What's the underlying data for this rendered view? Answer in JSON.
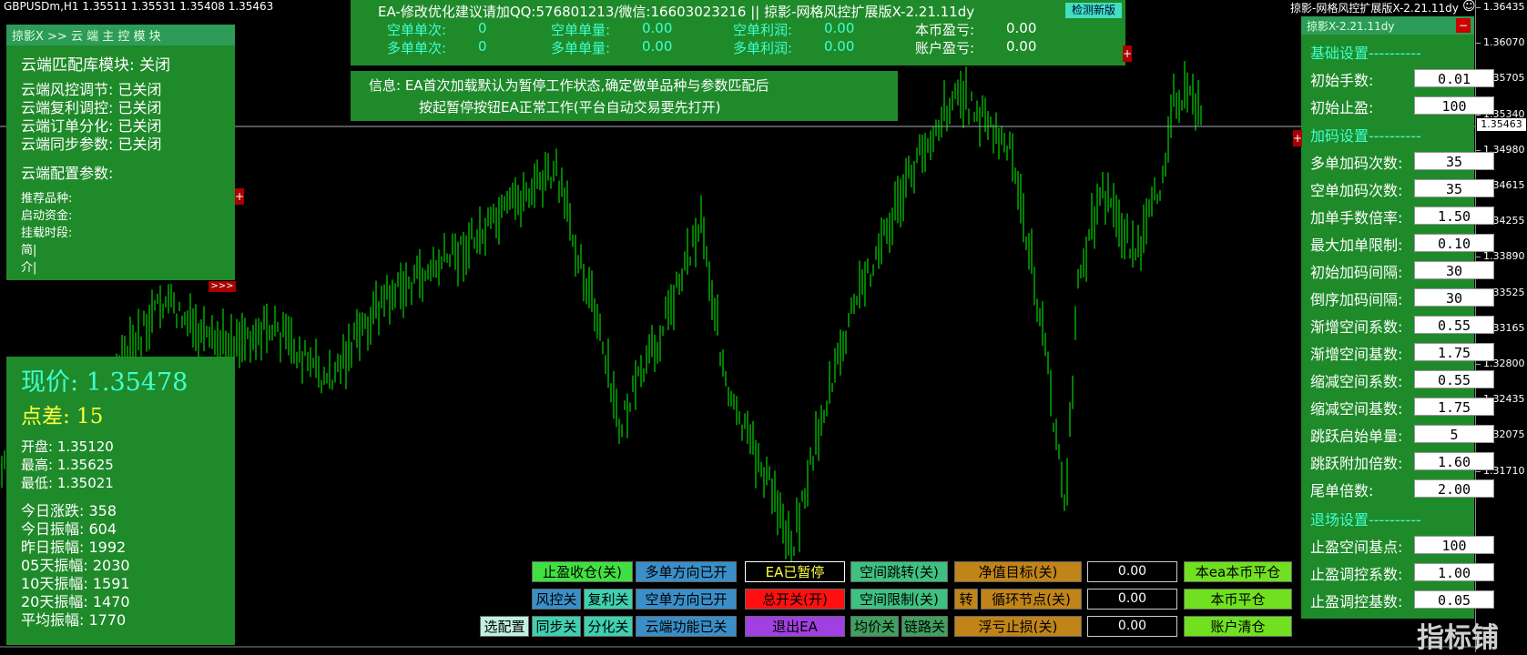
{
  "chart": {
    "symbol_line": "GBPUSDm,H1  1.35511  1.35531  1.35408  1.35463",
    "top_right_title": "掠影-网格风控扩展版X-2.21.11dy",
    "current_price_tag": "1.35463",
    "price_axis": [
      "1.36435",
      "1.36070",
      "1.35705",
      "1.35340",
      "1.34980",
      "1.34615",
      "1.34255",
      "1.33890",
      "1.33525",
      "1.33165",
      "1.32800",
      "1.32435",
      "1.32075",
      "1.31710"
    ],
    "bar_color": "#00ff00"
  },
  "top_panel": {
    "title": "EA-修改优化建议请加QQ:576801213/微信:16603023216 || 掠影-网格风控扩展版X-2.21.11dy",
    "check_button": "检测新版",
    "stats": [
      {
        "label": "空单单次:",
        "value": "0"
      },
      {
        "label": "空单单量:",
        "value": "0.00"
      },
      {
        "label": "空单利润:",
        "value": "0.00"
      },
      {
        "label": "本币盈亏:",
        "value": "0.00"
      },
      {
        "label": "多单单次:",
        "value": "0"
      },
      {
        "label": "多单单量:",
        "value": "0.00"
      },
      {
        "label": "多单利润:",
        "value": "0.00"
      },
      {
        "label": "账户盈亏:",
        "value": "0.00"
      }
    ]
  },
  "info_panel": {
    "line1": "信息: EA首次加载默认为暂停工作状态,确定做单品种与参数匹配后",
    "line2": "按起暂停按钮EA正常工作(平台自动交易要先打开)"
  },
  "cloud_panel": {
    "header": "掠影X >> 云 端 主 控 模 块",
    "match": "云端匹配库模块: 关闭",
    "items": [
      "云端风控调节: 已关闭",
      "云端复利调控: 已关闭",
      "云端订单分化: 已关闭",
      "云端同步参数: 已关闭"
    ],
    "config_title": "云端配置参数:",
    "config_items": [
      "推荐品种:",
      "启动资金:",
      "挂载时段:",
      "简|",
      "介|"
    ],
    "expand": ">>>"
  },
  "price_panel": {
    "current": "现价: 1.35478",
    "spread": "点差: 15",
    "ohl": [
      "开盘: 1.35120",
      "最高: 1.35625",
      "最低: 1.35021"
    ],
    "stats": [
      "今日涨跌: 358",
      "今日振幅: 604",
      "昨日振幅: 1992",
      "05天振幅: 2030",
      "10天振幅: 1591",
      "20天振幅: 1470",
      "平均振幅: 1770"
    ]
  },
  "right_panel": {
    "title": "掠影X-2.21.11dy",
    "close": "−",
    "section1": "基础设置----------",
    "section2": "加码设置----------",
    "section3": "退场设置----------",
    "basic": [
      {
        "label": "初始手数:",
        "value": "0.01"
      },
      {
        "label": "初始止盈:",
        "value": "100"
      }
    ],
    "add": [
      {
        "label": "多单加码次数:",
        "value": "35"
      },
      {
        "label": "空单加码次数:",
        "value": "35"
      },
      {
        "label": "加单手数倍率:",
        "value": "1.50"
      },
      {
        "label": "最大加单限制:",
        "value": "0.10"
      },
      {
        "label": "初始加码间隔:",
        "value": "30"
      },
      {
        "label": "倒序加码间隔:",
        "value": "30"
      },
      {
        "label": "渐增空间系数:",
        "value": "0.55"
      },
      {
        "label": "渐增空间基数:",
        "value": "1.75"
      },
      {
        "label": "缩减空间系数:",
        "value": "0.55"
      },
      {
        "label": "缩减空间基数:",
        "value": "1.75"
      },
      {
        "label": "跳跃启始单量:",
        "value": "5"
      },
      {
        "label": "跳跃附加倍数:",
        "value": "1.60"
      },
      {
        "label": "尾单倍数:",
        "value": "2.00"
      }
    ],
    "exit": [
      {
        "label": "止盈空间基点:",
        "value": "100"
      },
      {
        "label": "止盈调控系数:",
        "value": "1.00"
      },
      {
        "label": "止盈调控基数:",
        "value": "0.05"
      }
    ]
  },
  "buttons": {
    "tp_close": "止盈收仓(关)",
    "long_dir": "多单方向已开",
    "ea_paused": "EA已暂停",
    "space_jump": "空间跳转(关)",
    "equity_target": "净值目标(关)",
    "val1": "0.00",
    "this_ea_flat": "本ea本币平仓",
    "risk_off": "风控关",
    "compound_off": "复利关",
    "short_dir": "空单方向已开",
    "master_switch": "总开关(开)",
    "space_limit": "空间限制(关)",
    "turn": "转",
    "cycle_node": "循环节点(关)",
    "val2": "0.00",
    "local_flat": "本币平仓",
    "select_config": "选配置",
    "sync_off": "同步关",
    "split_off": "分化关",
    "cloud_off": "云端功能已关",
    "exit_ea": "退出EA",
    "avg_off": "均价关",
    "chain_off": "链路关",
    "float_sl": "浮亏止损(关)",
    "val3": "0.00",
    "account_clear": "账户清仓"
  },
  "watermark": "指标铺"
}
